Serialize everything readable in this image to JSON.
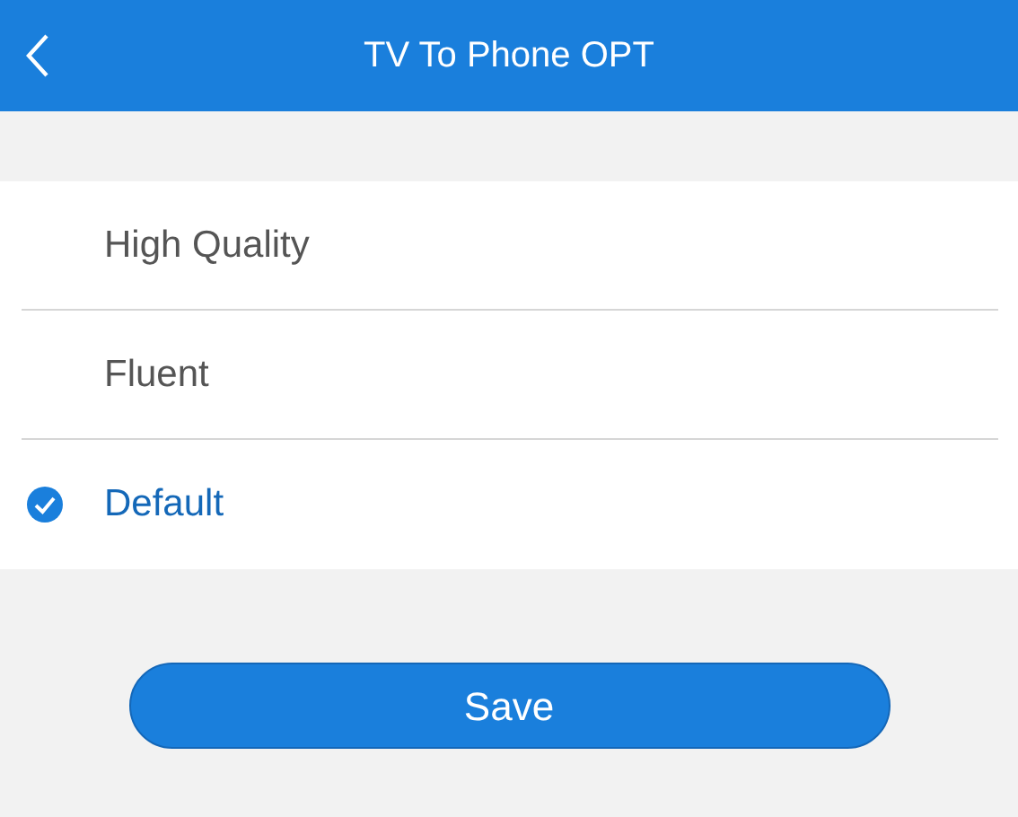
{
  "header": {
    "title": "TV To Phone OPT"
  },
  "options": [
    {
      "label": "High Quality",
      "selected": false
    },
    {
      "label": "Fluent",
      "selected": false
    },
    {
      "label": "Default",
      "selected": true
    }
  ],
  "button": "Save"
}
